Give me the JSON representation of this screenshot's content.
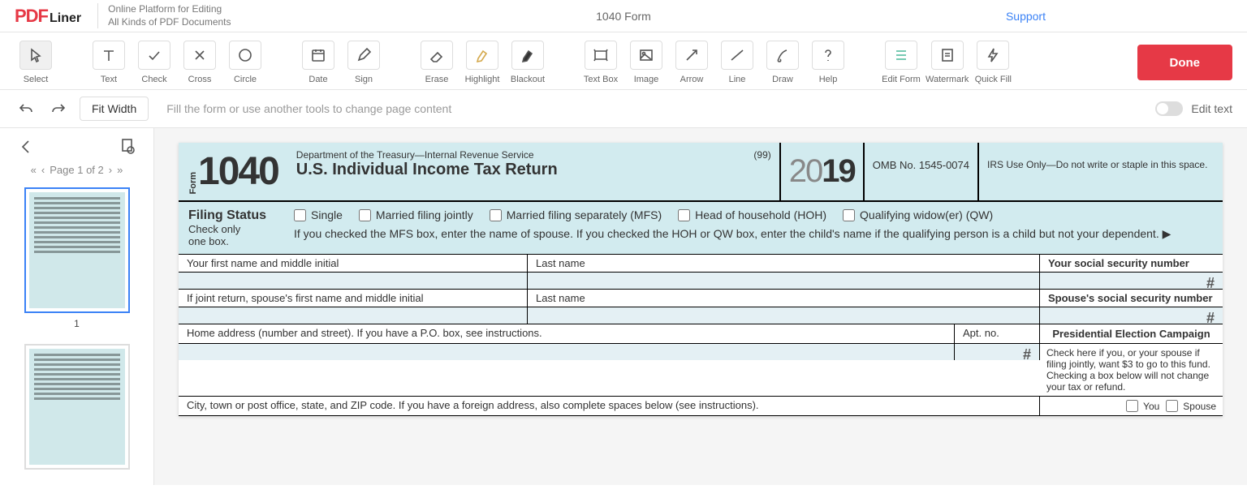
{
  "brand": {
    "pdf": "PDF",
    "liner": "Liner",
    "tagline1": "Online Platform for Editing",
    "tagline2": "All Kinds of PDF Documents"
  },
  "header": {
    "doc": "1040 Form",
    "support": "Support"
  },
  "tools": {
    "select": "Select",
    "text": "Text",
    "check": "Check",
    "cross": "Cross",
    "circle": "Circle",
    "date": "Date",
    "sign": "Sign",
    "erase": "Erase",
    "highlight": "Highlight",
    "blackout": "Blackout",
    "textbox": "Text Box",
    "image": "Image",
    "arrow": "Arrow",
    "line": "Line",
    "draw": "Draw",
    "help": "Help",
    "editform": "Edit Form",
    "watermark": "Watermark",
    "quickfill": "Quick Fill",
    "done": "Done"
  },
  "secondary": {
    "fit": "Fit Width",
    "hint": "Fill the form or use another tools to change page content",
    "edittext": "Edit text"
  },
  "pager": {
    "label": "Page 1 of 2",
    "thumb1": "1"
  },
  "form": {
    "word": "Form",
    "num": "1040",
    "dept": "Department of the Treasury—Internal Revenue Service",
    "c99": "(99)",
    "title": "U.S. Individual Income Tax Return",
    "y20": "20",
    "y19": "19",
    "omb": "OMB No. 1545-0074",
    "irs": "IRS Use Only—Do not write or staple in this space.",
    "filing": {
      "title": "Filing Status",
      "sub1": "Check only",
      "sub2": "one box.",
      "single": "Single",
      "mfj": "Married filing jointly",
      "mfs": "Married filing separately (MFS)",
      "hoh": "Head of household (HOH)",
      "qw": "Qualifying widow(er) (QW)",
      "note": "If you checked the MFS box, enter the name of spouse. If you checked the HOH or QW box, enter the child's name if the qualifying person is a child but not your dependent.  ▶"
    },
    "rows": {
      "fname": "Your first name and middle initial",
      "lname": "Last name",
      "ssn": "Your social security number",
      "sfname": "If joint return, spouse's first name and middle initial",
      "slname": "Last name",
      "sssn": "Spouse's social security number",
      "addr": "Home address (number and street). If you have a P.O. box, see instructions.",
      "apt": "Apt. no.",
      "city": "City, town or post office, state, and ZIP code. If you have a foreign address, also complete spaces below (see instructions).",
      "pres_title": "Presidential Election Campaign",
      "pres_text": "Check here if you, or your spouse if filing jointly, want $3 to go to this fund. Checking a box below will not change your tax or refund.",
      "you": "You",
      "spouse": "Spouse",
      "hash": "#"
    }
  }
}
